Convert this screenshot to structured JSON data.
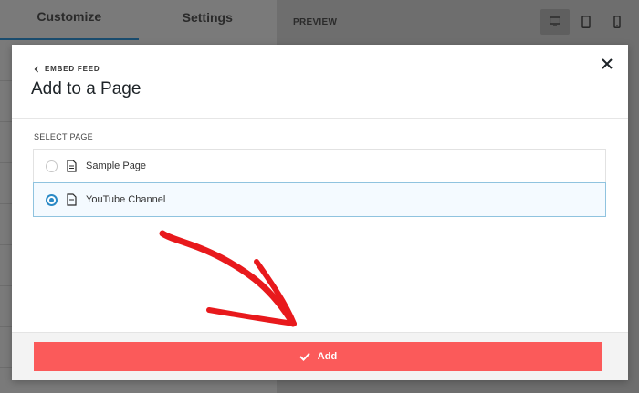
{
  "background": {
    "tabs": [
      {
        "label": "Customize",
        "active": true
      },
      {
        "label": "Settings",
        "active": false
      }
    ],
    "preview_label": "PREVIEW",
    "devices": [
      "desktop-icon",
      "tablet-icon",
      "mobile-icon"
    ]
  },
  "modal": {
    "back_label": "EMBED FEED",
    "title": "Add to a Page",
    "section_label": "SELECT PAGE",
    "pages": [
      {
        "name": "Sample Page",
        "selected": false
      },
      {
        "name": "YouTube Channel",
        "selected": true
      }
    ],
    "add_label": "Add"
  },
  "colors": {
    "accent": "#2b8ac6",
    "add_button": "#fb5a5a",
    "annotation_arrow": "#e8191c"
  }
}
